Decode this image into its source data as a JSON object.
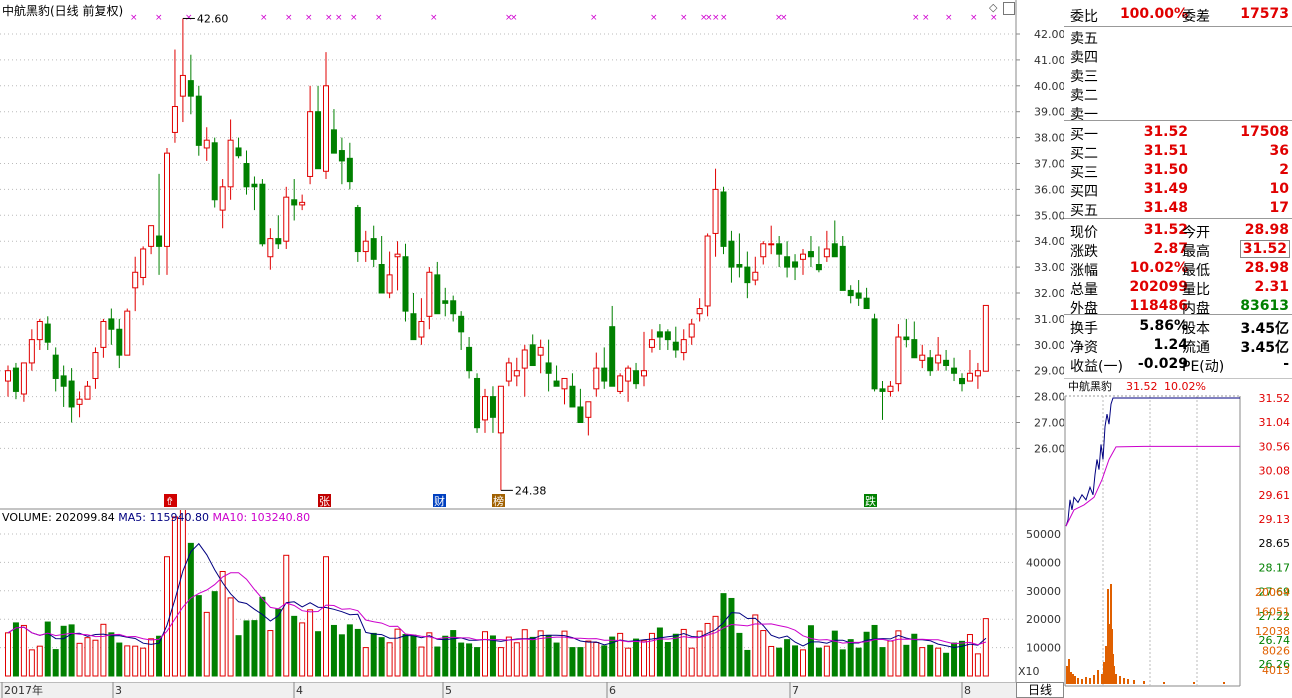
{
  "chart_title": "中航黑豹(日线 前复权)",
  "price_axis": [
    "42.00",
    "41.00",
    "40.00",
    "39.00",
    "38.00",
    "37.00",
    "36.00",
    "35.00",
    "34.00",
    "33.00",
    "32.00",
    "31.00",
    "30.00",
    "29.00",
    "28.00",
    "27.00",
    "26.00"
  ],
  "annotations": {
    "high": "42.60",
    "low": "24.38"
  },
  "event_markers": [
    {
      "text": "⇮",
      "color": "#d00000"
    },
    {
      "text": "张",
      "color": "#c00000"
    },
    {
      "text": "财",
      "color": "#0040c0"
    },
    {
      "text": "榜",
      "color": "#a06000"
    },
    {
      "text": "跌",
      "color": "#008000"
    }
  ],
  "volume": {
    "label_volume": "VOLUME: 202099.84",
    "label_ma5": "MA5: 115940.80",
    "label_ma10": "MA10: 103240.80",
    "axis": [
      "50000",
      "40000",
      "30000",
      "20000",
      "10000"
    ],
    "x10": "X10"
  },
  "date_axis": [
    "2017年",
    "3",
    "4",
    "5",
    "6",
    "7",
    "8"
  ],
  "period_button": "日线",
  "quote": {
    "weibi_label": "委比",
    "weibi_value": "100.00%",
    "weicha_label": "委差",
    "weicha_value": "17573",
    "sell": [
      "卖五",
      "卖四",
      "卖三",
      "卖二",
      "卖一"
    ],
    "buy": [
      {
        "label": "买一",
        "price": "31.52",
        "vol": "17508"
      },
      {
        "label": "买二",
        "price": "31.51",
        "vol": "36"
      },
      {
        "label": "买三",
        "price": "31.50",
        "vol": "2"
      },
      {
        "label": "买四",
        "price": "31.49",
        "vol": "10"
      },
      {
        "label": "买五",
        "price": "31.48",
        "vol": "17"
      }
    ],
    "stats": [
      {
        "l1": "现价",
        "v1": "31.52",
        "l2": "今开",
        "v2": "28.98"
      },
      {
        "l1": "涨跌",
        "v1": "2.87",
        "l2": "最高",
        "v2": "31.52"
      },
      {
        "l1": "涨幅",
        "v1": "10.02%",
        "l2": "最低",
        "v2": "28.98"
      },
      {
        "l1": "总量",
        "v1": "202099",
        "l2": "量比",
        "v2": "2.31"
      },
      {
        "l1": "外盘",
        "v1": "118486",
        "l2": "内盘",
        "v2": "83613"
      }
    ],
    "stats2": [
      {
        "l1": "换手",
        "v1": "5.86%",
        "l2": "股本",
        "v2": "3.45亿"
      },
      {
        "l1": "净资",
        "v1": "1.24",
        "l2": "流通",
        "v2": "3.45亿"
      },
      {
        "l1": "收益(一)",
        "v1": "-0.029",
        "l2": "PE(动)",
        "v2": "-"
      }
    ]
  },
  "intraday": {
    "name": "中航黑豹",
    "price": "31.52",
    "pct": "10.02%",
    "axis": [
      "31.52",
      "31.04",
      "30.56",
      "30.08",
      "29.61",
      "29.13",
      "28.65",
      "28.17",
      "27.69",
      "27.22",
      "26.74",
      "26.26"
    ],
    "vol_axis": [
      "20064",
      "16051",
      "12038",
      "8026",
      "4013"
    ]
  },
  "chart_data": {
    "type": "candlestick",
    "title": "中航黑豹(日线 前复权)",
    "ylim": [
      24.0,
      42.9
    ],
    "candles": [
      [
        28.6,
        29.2,
        28.0,
        29.0
      ],
      [
        29.1,
        29.3,
        27.9,
        28.2
      ],
      [
        28.1,
        29.3,
        27.8,
        29.3
      ],
      [
        29.3,
        30.6,
        29.0,
        30.2
      ],
      [
        30.2,
        31.0,
        29.8,
        30.9
      ],
      [
        30.8,
        31.1,
        29.8,
        30.1
      ],
      [
        29.6,
        29.9,
        28.2,
        28.7
      ],
      [
        28.8,
        29.2,
        27.6,
        28.4
      ],
      [
        28.6,
        29.1,
        27.0,
        27.6
      ],
      [
        27.7,
        28.2,
        27.2,
        27.9
      ],
      [
        27.9,
        28.6,
        27.9,
        28.4
      ],
      [
        28.7,
        29.9,
        28.3,
        29.7
      ],
      [
        29.9,
        31.0,
        29.5,
        30.9
      ],
      [
        31.0,
        31.4,
        30.0,
        30.6
      ],
      [
        30.6,
        31.0,
        29.1,
        29.6
      ],
      [
        29.6,
        31.4,
        29.6,
        31.3
      ],
      [
        32.2,
        33.4,
        31.3,
        32.8
      ],
      [
        32.6,
        33.8,
        32.3,
        33.7
      ],
      [
        33.8,
        34.6,
        33.5,
        34.6
      ],
      [
        34.2,
        36.6,
        32.7,
        33.8
      ],
      [
        33.8,
        37.6,
        32.7,
        37.4
      ],
      [
        38.2,
        41.4,
        37.8,
        39.2
      ],
      [
        39.6,
        42.6,
        38.6,
        40.4
      ],
      [
        40.2,
        41.2,
        38.9,
        39.6
      ],
      [
        39.6,
        40.0,
        37.3,
        37.7
      ],
      [
        37.6,
        38.4,
        37.1,
        37.9
      ],
      [
        37.8,
        38.0,
        35.3,
        35.6
      ],
      [
        35.2,
        36.4,
        34.5,
        36.1
      ],
      [
        36.1,
        38.7,
        35.6,
        37.9
      ],
      [
        37.6,
        38.0,
        37.2,
        37.3
      ],
      [
        37.0,
        37.5,
        35.8,
        36.1
      ],
      [
        36.2,
        36.5,
        35.2,
        36.1
      ],
      [
        36.2,
        36.4,
        33.8,
        33.9
      ],
      [
        33.4,
        34.5,
        32.9,
        34.1
      ],
      [
        34.1,
        35.0,
        33.7,
        33.9
      ],
      [
        34.0,
        36.1,
        33.7,
        35.7
      ],
      [
        35.6,
        36.4,
        34.8,
        35.4
      ],
      [
        35.4,
        35.8,
        35.2,
        35.5
      ],
      [
        36.5,
        40.0,
        36.2,
        39.0
      ],
      [
        39.0,
        40.0,
        36.8,
        36.8
      ],
      [
        36.7,
        41.3,
        36.4,
        40.0
      ],
      [
        38.3,
        39.1,
        37.8,
        37.4
      ],
      [
        37.5,
        38.0,
        36.2,
        37.1
      ],
      [
        37.2,
        37.8,
        36.0,
        36.3
      ],
      [
        35.3,
        35.4,
        33.2,
        33.6
      ],
      [
        33.6,
        34.4,
        33.2,
        34.0
      ],
      [
        34.1,
        34.6,
        33.0,
        33.3
      ],
      [
        33.1,
        34.2,
        32.5,
        32.0
      ],
      [
        32.0,
        33.6,
        31.8,
        32.7
      ],
      [
        33.4,
        34.0,
        32.1,
        33.5
      ],
      [
        33.4,
        33.9,
        30.9,
        31.3
      ],
      [
        31.2,
        32.0,
        30.4,
        30.2
      ],
      [
        30.3,
        31.8,
        30.0,
        30.9
      ],
      [
        31.1,
        33.0,
        30.6,
        32.8
      ],
      [
        32.7,
        33.2,
        31.3,
        31.2
      ],
      [
        31.7,
        32.2,
        31.1,
        31.6
      ],
      [
        31.7,
        31.9,
        30.9,
        31.2
      ],
      [
        31.1,
        31.3,
        29.8,
        30.5
      ],
      [
        29.9,
        30.3,
        28.7,
        29.0
      ],
      [
        28.7,
        28.9,
        26.6,
        26.8
      ],
      [
        27.1,
        28.3,
        26.6,
        28.0
      ],
      [
        28.0,
        28.4,
        26.6,
        27.2
      ],
      [
        26.6,
        28.4,
        24.38,
        28.4
      ],
      [
        28.6,
        29.5,
        28.4,
        29.3
      ],
      [
        28.8,
        29.5,
        28.4,
        29.0
      ],
      [
        29.1,
        30.0,
        28.0,
        29.8
      ],
      [
        30.0,
        30.4,
        29.8,
        29.2
      ],
      [
        29.6,
        30.2,
        28.9,
        29.9
      ],
      [
        29.3,
        30.2,
        28.2,
        28.9
      ],
      [
        28.6,
        29.2,
        28.4,
        28.4
      ],
      [
        28.3,
        28.7,
        27.7,
        28.7
      ],
      [
        28.4,
        28.9,
        27.9,
        27.6
      ],
      [
        27.6,
        28.3,
        27.1,
        27.0
      ],
      [
        27.2,
        27.8,
        26.5,
        27.8
      ],
      [
        28.3,
        29.7,
        28.0,
        29.1
      ],
      [
        29.1,
        29.9,
        28.3,
        28.6
      ],
      [
        30.7,
        31.5,
        28.8,
        28.4
      ],
      [
        28.2,
        28.9,
        28.1,
        28.8
      ],
      [
        28.6,
        29.2,
        27.8,
        29.1
      ],
      [
        29.0,
        29.3,
        28.3,
        28.5
      ],
      [
        28.8,
        30.5,
        28.4,
        29.0
      ],
      [
        29.9,
        30.6,
        29.7,
        30.2
      ],
      [
        30.5,
        30.8,
        29.8,
        30.3
      ],
      [
        30.5,
        30.6,
        29.8,
        30.2
      ],
      [
        30.1,
        30.7,
        29.5,
        29.8
      ],
      [
        29.7,
        30.6,
        29.4,
        30.2
      ],
      [
        30.3,
        31.0,
        30.0,
        30.8
      ],
      [
        31.2,
        31.8,
        30.9,
        31.4
      ],
      [
        31.5,
        34.3,
        31.1,
        34.2
      ],
      [
        34.3,
        36.8,
        33.4,
        36.0
      ],
      [
        35.9,
        36.1,
        33.5,
        33.8
      ],
      [
        34.0,
        34.4,
        32.4,
        33.0
      ],
      [
        33.1,
        34.3,
        32.6,
        33.0
      ],
      [
        33.0,
        33.6,
        31.8,
        32.4
      ],
      [
        32.5,
        33.4,
        32.3,
        32.8
      ],
      [
        33.4,
        34.0,
        33.1,
        33.9
      ],
      [
        33.9,
        34.6,
        33.5,
        33.9
      ],
      [
        33.9,
        34.2,
        33.0,
        33.5
      ],
      [
        33.4,
        34.0,
        32.6,
        33.0
      ],
      [
        33.2,
        33.5,
        32.5,
        33.0
      ],
      [
        33.3,
        33.7,
        32.7,
        33.5
      ],
      [
        33.6,
        34.2,
        33.0,
        33.4
      ],
      [
        33.1,
        33.8,
        32.8,
        32.9
      ],
      [
        33.4,
        34.4,
        33.2,
        33.7
      ],
      [
        33.9,
        34.8,
        33.4,
        33.4
      ],
      [
        33.8,
        34.2,
        33.0,
        32.1
      ],
      [
        32.1,
        32.3,
        31.6,
        31.9
      ],
      [
        32.0,
        32.5,
        31.5,
        31.8
      ],
      [
        31.8,
        32.2,
        31.5,
        31.4
      ],
      [
        31.0,
        31.2,
        28.2,
        28.3
      ],
      [
        28.3,
        28.6,
        27.1,
        28.2
      ],
      [
        28.2,
        28.6,
        28.0,
        28.4
      ],
      [
        28.5,
        30.8,
        28.2,
        30.3
      ],
      [
        30.3,
        31.0,
        29.9,
        30.2
      ],
      [
        30.2,
        30.9,
        29.5,
        29.5
      ],
      [
        29.4,
        30.0,
        29.1,
        29.6
      ],
      [
        29.5,
        29.8,
        28.8,
        29.0
      ],
      [
        29.3,
        30.3,
        29.0,
        29.6
      ],
      [
        29.4,
        29.8,
        29.0,
        29.2
      ],
      [
        29.1,
        29.5,
        28.6,
        28.9
      ],
      [
        28.7,
        28.9,
        28.2,
        28.5
      ],
      [
        28.6,
        29.8,
        28.6,
        28.9
      ],
      [
        28.8,
        29.3,
        28.3,
        29.0
      ],
      [
        28.98,
        31.52,
        28.98,
        31.52
      ]
    ],
    "volume": [
      15200,
      18700,
      17800,
      9200,
      10500,
      19000,
      9300,
      17500,
      18000,
      11500,
      13500,
      12600,
      18200,
      15200,
      11600,
      10600,
      10500,
      9800,
      13100,
      14000,
      42000,
      56000,
      60000,
      46700,
      28300,
      22400,
      29700,
      36800,
      27500,
      14200,
      19400,
      19500,
      27700,
      16000,
      23500,
      42500,
      21000,
      18700,
      23300,
      15600,
      42000,
      17800,
      14500,
      18000,
      16400,
      10000,
      15000,
      13500,
      11700,
      16500,
      14600,
      14400,
      10200,
      15200,
      10200,
      14000,
      16000,
      11600,
      11300,
      10000,
      15600,
      14100,
      10000,
      13700,
      11700,
      16300,
      13600,
      15900,
      14300,
      11600,
      15800,
      10000,
      10000,
      12300,
      11800,
      10600,
      13700,
      15000,
      9800,
      13000,
      12400,
      15000,
      16900,
      11800,
      14700,
      16400,
      9800,
      15800,
      18500,
      21000,
      29000,
      27300,
      15000,
      9000,
      21500,
      16000,
      10400,
      9800,
      12800,
      10600,
      9200,
      17700,
      9800,
      10500,
      15800,
      9200,
      12800,
      9800,
      15400,
      17800,
      10000,
      12300,
      15900,
      10800,
      14700,
      10000,
      10800,
      9800,
      8000,
      11600,
      12200,
      14600,
      7800,
      20200
    ]
  }
}
